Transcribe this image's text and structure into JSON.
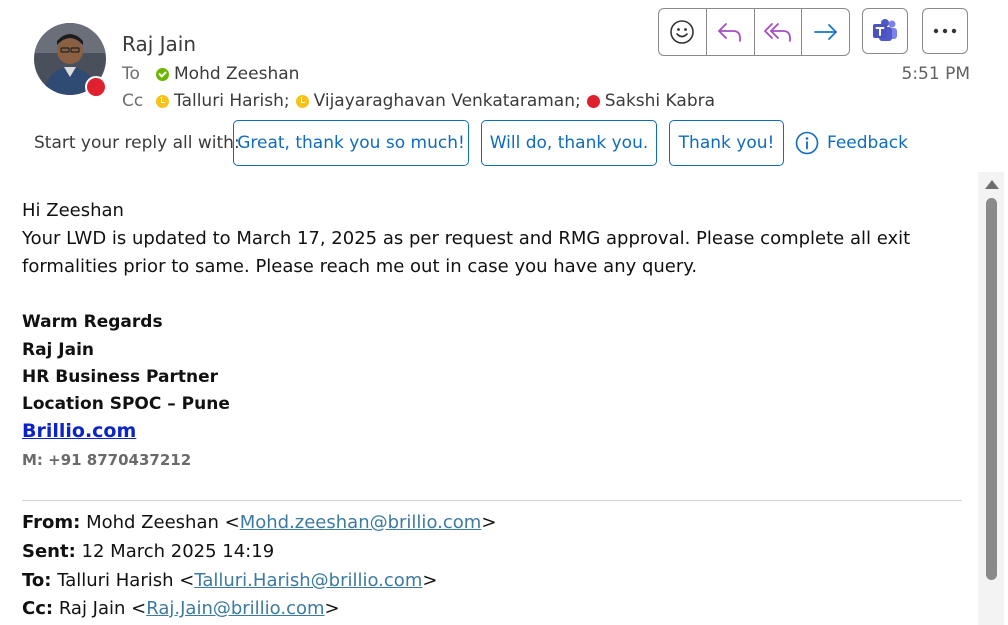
{
  "message": {
    "sender_name": "Raj Jain",
    "to_label": "To",
    "to": [
      {
        "name": "Mohd Zeeshan",
        "status": "available"
      }
    ],
    "cc_label": "Cc",
    "cc": [
      {
        "name": "Talluri Harish;",
        "status": "away"
      },
      {
        "name": "Vijayaraghavan Venkataraman;",
        "status": "away"
      },
      {
        "name": "Sakshi Kabra",
        "status": "busy"
      }
    ],
    "time": "5:51 PM"
  },
  "toolbar": {
    "icons": [
      "emoji-icon",
      "reply-icon",
      "reply-all-icon",
      "forward-icon",
      "teams-icon",
      "more-icon"
    ]
  },
  "suggested_replies": {
    "label": "Start your reply all with:",
    "chips": [
      "Great, thank you so much!",
      "Will do, thank you.",
      "Thank you!"
    ],
    "feedback": "Feedback"
  },
  "body": {
    "greeting": "Hi Zeeshan",
    "paragraph": "Your LWD is updated to March 17, 2025 as per request and RMG approval. Please complete all exit formalities prior to same. Please reach me out in case you have any query.",
    "signature": {
      "closing": "Warm Regards",
      "name": "Raj Jain",
      "title": "HR Business Partner",
      "location": "Location SPOC – Pune",
      "link": "Brillio.com",
      "phone": "M: +91 8770437212"
    }
  },
  "quoted": {
    "from_label": "From:",
    "from_name": "Mohd Zeeshan <",
    "from_email": "Mohd.zeeshan@brillio.com",
    "sent_label": "Sent:",
    "sent": "12 March 2025 14:19",
    "to_label": "To:",
    "to_name": "Talluri Harish <",
    "to_email": "Talluri.Harish@brillio.com",
    "cc_label": "Cc:",
    "cc_name": "Raj Jain <",
    "cc_email": "Raj.Jain@brillio.com",
    "close": ">"
  },
  "colors": {
    "accent": "#0f6cbd",
    "available": "#6bb700",
    "away": "#f8c21b",
    "busy": "#e0202e",
    "signature_link": "#0b23c8",
    "quoted_link": "#3c7a9e"
  }
}
